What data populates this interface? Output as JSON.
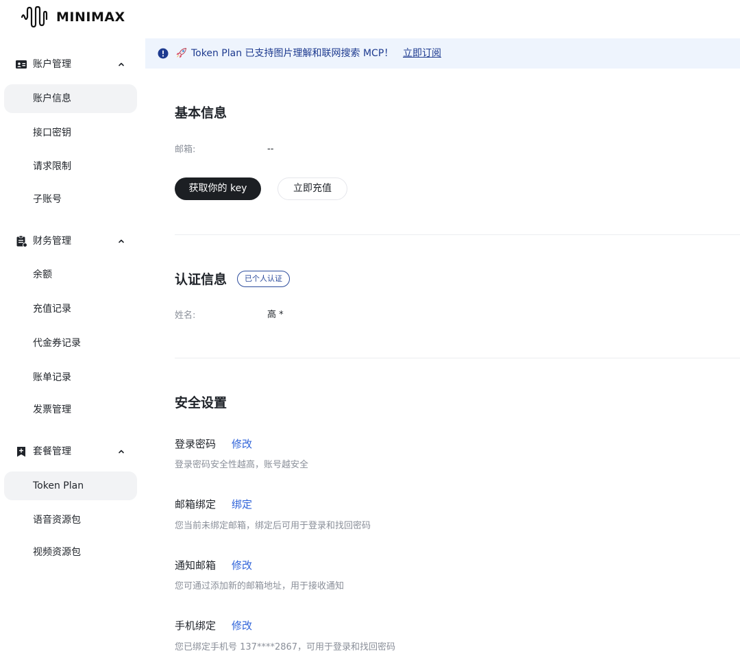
{
  "brand": {
    "name": "MINIMAX",
    "logo_icon": "waveform-logo"
  },
  "sidebar": {
    "groups": [
      {
        "label": "账户管理",
        "icon": "id-card-icon",
        "items": [
          "账户信息",
          "接口密钥",
          "请求限制",
          "子账号"
        ]
      },
      {
        "label": "财务管理",
        "icon": "clipboard-icon",
        "items": [
          "余额",
          "充值记录",
          "代金券记录",
          "账单记录",
          "发票管理"
        ]
      },
      {
        "label": "套餐管理",
        "icon": "bookmark-plus-icon",
        "items": [
          "Token Plan",
          "语音资源包",
          "视频资源包"
        ]
      }
    ],
    "active_items": [
      "账户信息",
      "Token Plan"
    ]
  },
  "banner": {
    "text": "Token Plan 已支持图片理解和联网搜索 MCP！",
    "link": "立即订阅",
    "icon": "info-icon",
    "emoji": "rocket-icon"
  },
  "basic": {
    "title": "基本信息",
    "email_label": "邮箱:",
    "email_value": "--",
    "get_key_button": "获取你的 key",
    "recharge_button": "立即充值"
  },
  "auth": {
    "title": "认证信息",
    "badge": "已个人认证",
    "name_label": "姓名:",
    "name_value": "高 *"
  },
  "security": {
    "title": "安全设置",
    "items": [
      {
        "title": "登录密码",
        "action": "修改",
        "desc": "登录密码安全性越高，账号越安全"
      },
      {
        "title": "邮箱绑定",
        "action": "绑定",
        "desc": "您当前未绑定邮箱，绑定后可用于登录和找回密码"
      },
      {
        "title": "通知邮箱",
        "action": "修改",
        "desc": "您可通过添加新的邮箱地址，用于接收通知"
      },
      {
        "title": "手机绑定",
        "action": "修改",
        "desc": "您已绑定手机号 137****2867，可用于登录和找回密码"
      }
    ]
  },
  "colors": {
    "accent_link": "#2f63d9",
    "banner_bg": "#eef4fd",
    "banner_text": "#1d3a8f",
    "dark_button": "#1c1f23"
  }
}
